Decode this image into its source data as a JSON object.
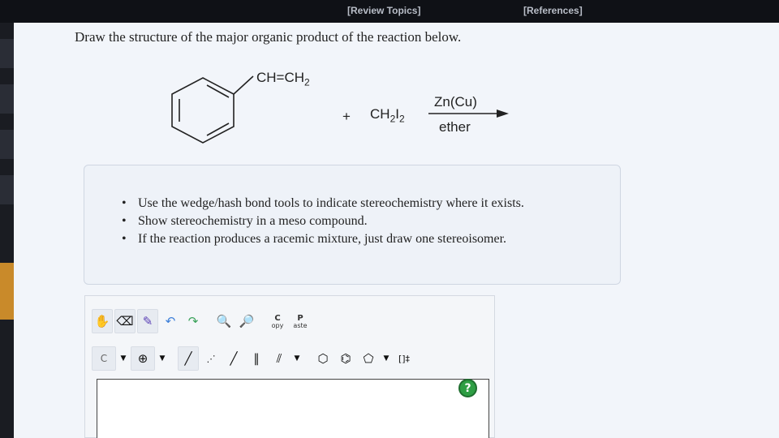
{
  "topbar": {
    "review_topics": "[Review Topics]",
    "references": "[References]"
  },
  "question": {
    "prompt": "Draw the structure of the major organic product of the reaction below."
  },
  "reaction": {
    "substituent": "CH=CH",
    "substituent_sub": "2",
    "plus": "+",
    "reagent_main": "CH",
    "reagent_sub1": "2",
    "reagent_i": "I",
    "reagent_sub2": "2",
    "catalyst": "Zn(Cu)",
    "solvent": "ether"
  },
  "instructions": [
    "Use the wedge/hash bond tools to indicate stereochemistry where it exists.",
    "Show stereochemistry in a meso compound.",
    "If the reaction produces a racemic mixture, just draw one stereoisomer."
  ],
  "editor": {
    "copy_label": "C",
    "copy_sub": "opy",
    "paste_label": "P",
    "paste_sub": "aste",
    "atom_label": "C",
    "charge_label": "⊕",
    "bracket_label": "[]‡",
    "help_label": "?"
  }
}
